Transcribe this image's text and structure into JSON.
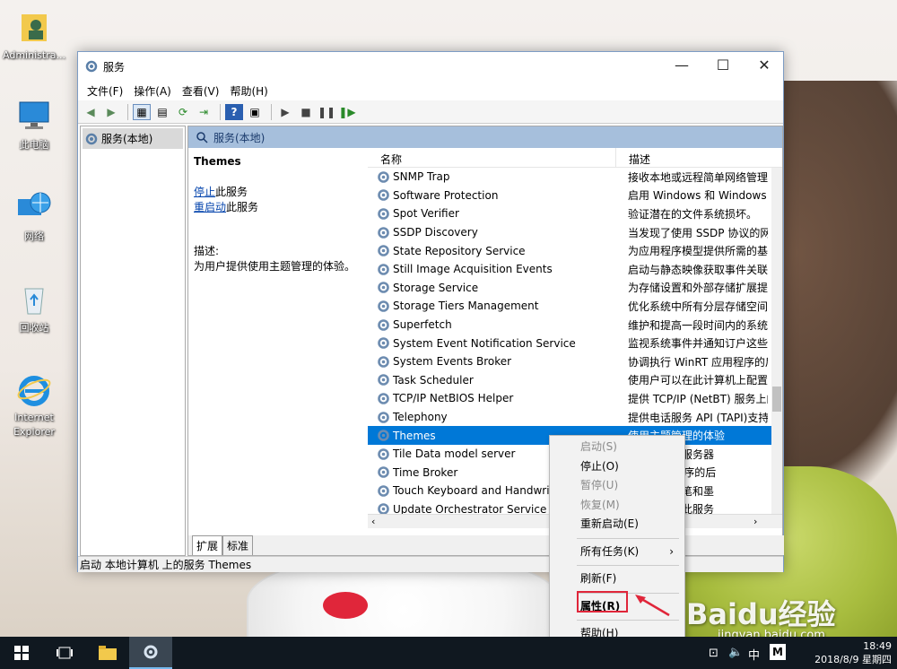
{
  "desktop": {
    "icons": [
      {
        "label": "Administra..."
      },
      {
        "label": "此电脑"
      },
      {
        "label": "网络"
      },
      {
        "label": "回收站"
      },
      {
        "label": "Internet Explorer"
      }
    ]
  },
  "window": {
    "title": "服务",
    "menu": [
      "文件(F)",
      "操作(A)",
      "查看(V)",
      "帮助(H)"
    ],
    "tree_root": "服务(本地)",
    "header": "服务(本地)",
    "selected_service": "Themes",
    "stop_link": "停止",
    "stop_suffix": "此服务",
    "restart_link": "重启动",
    "restart_suffix": "此服务",
    "desc_label": "描述:",
    "desc_text": "为用户提供使用主题管理的体验。",
    "columns": {
      "name": "名称",
      "description": "描述"
    },
    "rows": [
      {
        "name": "SNMP Trap",
        "desc": "接收本地或远程简单网络管理协"
      },
      {
        "name": "Software Protection",
        "desc": "启用 Windows 和 Windows 应"
      },
      {
        "name": "Spot Verifier",
        "desc": "验证潜在的文件系统损坏。"
      },
      {
        "name": "SSDP Discovery",
        "desc": "当发现了使用 SSDP 协议的网络"
      },
      {
        "name": "State Repository Service",
        "desc": "为应用程序模型提供所需的基础"
      },
      {
        "name": "Still Image Acquisition Events",
        "desc": "启动与静态映像获取事件关联的"
      },
      {
        "name": "Storage Service",
        "desc": "为存储设置和外部存储扩展提供"
      },
      {
        "name": "Storage Tiers Management",
        "desc": "优化系统中所有分层存储空间"
      },
      {
        "name": "Superfetch",
        "desc": "维护和提高一段时间内的系统性"
      },
      {
        "name": "System Event Notification Service",
        "desc": "监视系统事件并通知订户这些事"
      },
      {
        "name": "System Events Broker",
        "desc": "协调执行 WinRT 应用程序的后"
      },
      {
        "name": "Task Scheduler",
        "desc": "使用户可以在此计算机上配置和"
      },
      {
        "name": "TCP/IP NetBIOS Helper",
        "desc": "提供 TCP/IP (NetBT) 服务上的"
      },
      {
        "name": "Telephony",
        "desc": "提供电话服务 API (TAPI)支持"
      },
      {
        "name": "Themes",
        "desc": "使用主题管理的体验",
        "selected": true
      },
      {
        "name": "Tile Data model server",
        "desc": "更新的图块服务器"
      },
      {
        "name": "Time Broker",
        "desc": "nRT 应用程序的后"
      },
      {
        "name": "Touch Keyboard and Handwrit",
        "desc": "和手写面板笔和墨"
      },
      {
        "name": "Update Orchestrator Service fo",
        "desc": "更新。如果此服务"
      }
    ],
    "tabs": [
      "扩展",
      "标准"
    ],
    "status": "启动 本地计算机 上的服务 Themes"
  },
  "context_menu": {
    "items": [
      {
        "label": "启动(S)",
        "disabled": true
      },
      {
        "label": "停止(O)",
        "disabled": false
      },
      {
        "label": "暂停(U)",
        "disabled": true
      },
      {
        "label": "恢复(M)",
        "disabled": true
      },
      {
        "label": "重新启动(E)",
        "disabled": false
      },
      {
        "label": "所有任务(K)",
        "disabled": false,
        "submenu": true
      },
      {
        "label": "刷新(F)",
        "disabled": false
      },
      {
        "label": "属性(R)",
        "disabled": false,
        "highlighted": true
      },
      {
        "label": "帮助(H)",
        "disabled": false
      }
    ]
  },
  "taskbar": {
    "time": "18:49",
    "date": "2018/8/9 星期四",
    "ime": "中",
    "ime_mode": "M"
  },
  "watermark": {
    "logo": "Baidu经验",
    "url": "jingyan.baidu.com"
  },
  "colors": {
    "selection": "#0078d7",
    "accent_header": "#a6bfdc",
    "highlight_box": "#e0263a"
  }
}
